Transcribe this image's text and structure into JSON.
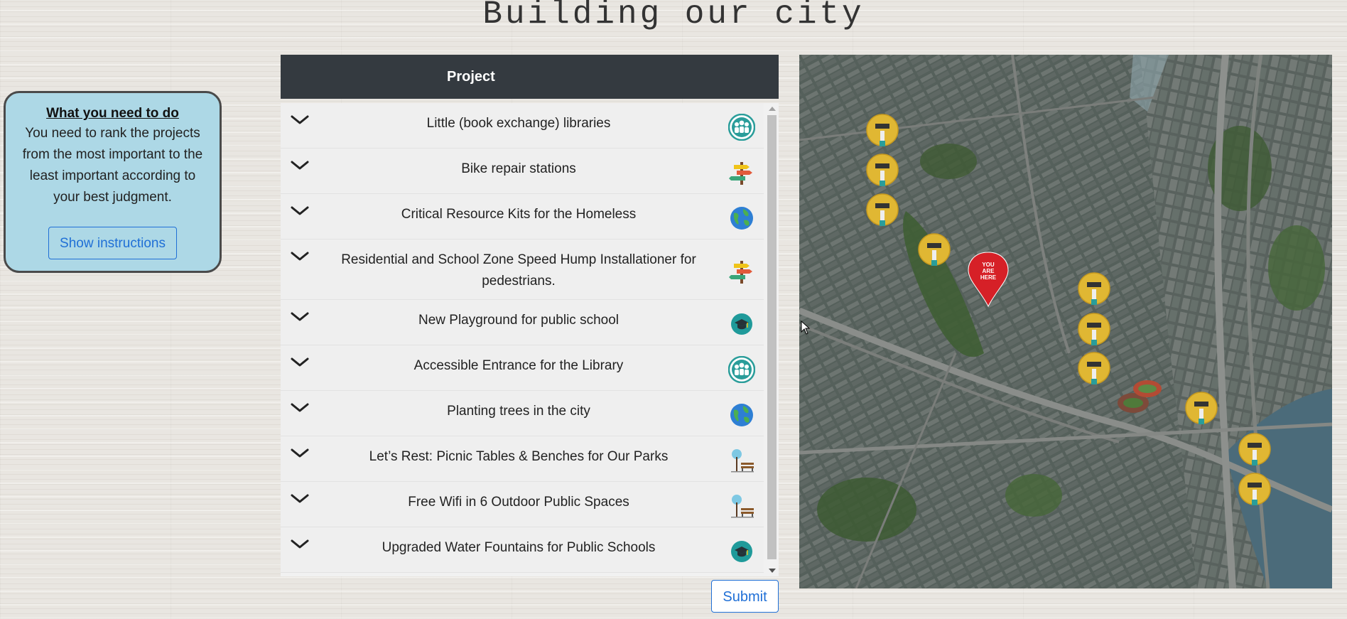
{
  "page": {
    "title": "Building our city"
  },
  "info": {
    "heading": "What you need to do",
    "text": "You need to rank the projects from the most important to the least important according to your best judgment.",
    "button_label": "Show instructions"
  },
  "table": {
    "header": "Project",
    "rows": [
      {
        "label": "Little (book exchange) libraries",
        "icon": "community-icon"
      },
      {
        "label": "Bike repair stations",
        "icon": "signpost-icon"
      },
      {
        "label": "Critical Resource Kits for the Homeless",
        "icon": "globe-icon"
      },
      {
        "label": "Residential and School Zone Speed Hump Installationer for pedestrians.",
        "icon": "signpost-icon"
      },
      {
        "label": "New Playground for public school",
        "icon": "graduation-cap-icon"
      },
      {
        "label": "Accessible Entrance for the Library",
        "icon": "community-icon"
      },
      {
        "label": "Planting trees in the city",
        "icon": "globe-icon"
      },
      {
        "label": "Let’s Rest: Picnic Tables & Benches for Our Parks",
        "icon": "park-bench-icon"
      },
      {
        "label": "Free Wifi in 6 Outdoor Public Spaces",
        "icon": "park-bench-icon"
      },
      {
        "label": "Upgraded Water Fountains for Public Schools",
        "icon": "graduation-cap-icon"
      }
    ],
    "submit_label": "Submit"
  },
  "map": {
    "you_are_here": [
      "YOU",
      "ARE",
      "HERE"
    ],
    "marker_count": 11
  },
  "colors": {
    "header_bg": "#343a40",
    "info_bg": "#add8e6",
    "button_blue": "#1f6fd6",
    "marker_yellow": "#e0b733",
    "you_are_here_red": "#d62027"
  }
}
